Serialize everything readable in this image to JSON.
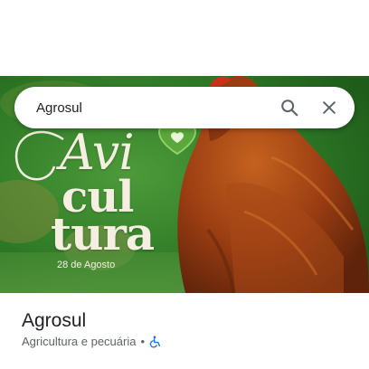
{
  "search": {
    "query": "Agrosul",
    "search_icon": "search-icon",
    "close_icon": "close-icon"
  },
  "hero": {
    "line1": "Avi",
    "line2": "cul",
    "line3": "tura",
    "date": "28 de Agosto",
    "accent_color": "#2f7a26"
  },
  "place": {
    "name": "Agrosul",
    "category": "Agricultura e pecuária",
    "separator": "•",
    "accessibility_icon": "wheelchair-accessible-icon",
    "accessibility_color": "#1a73e8"
  }
}
